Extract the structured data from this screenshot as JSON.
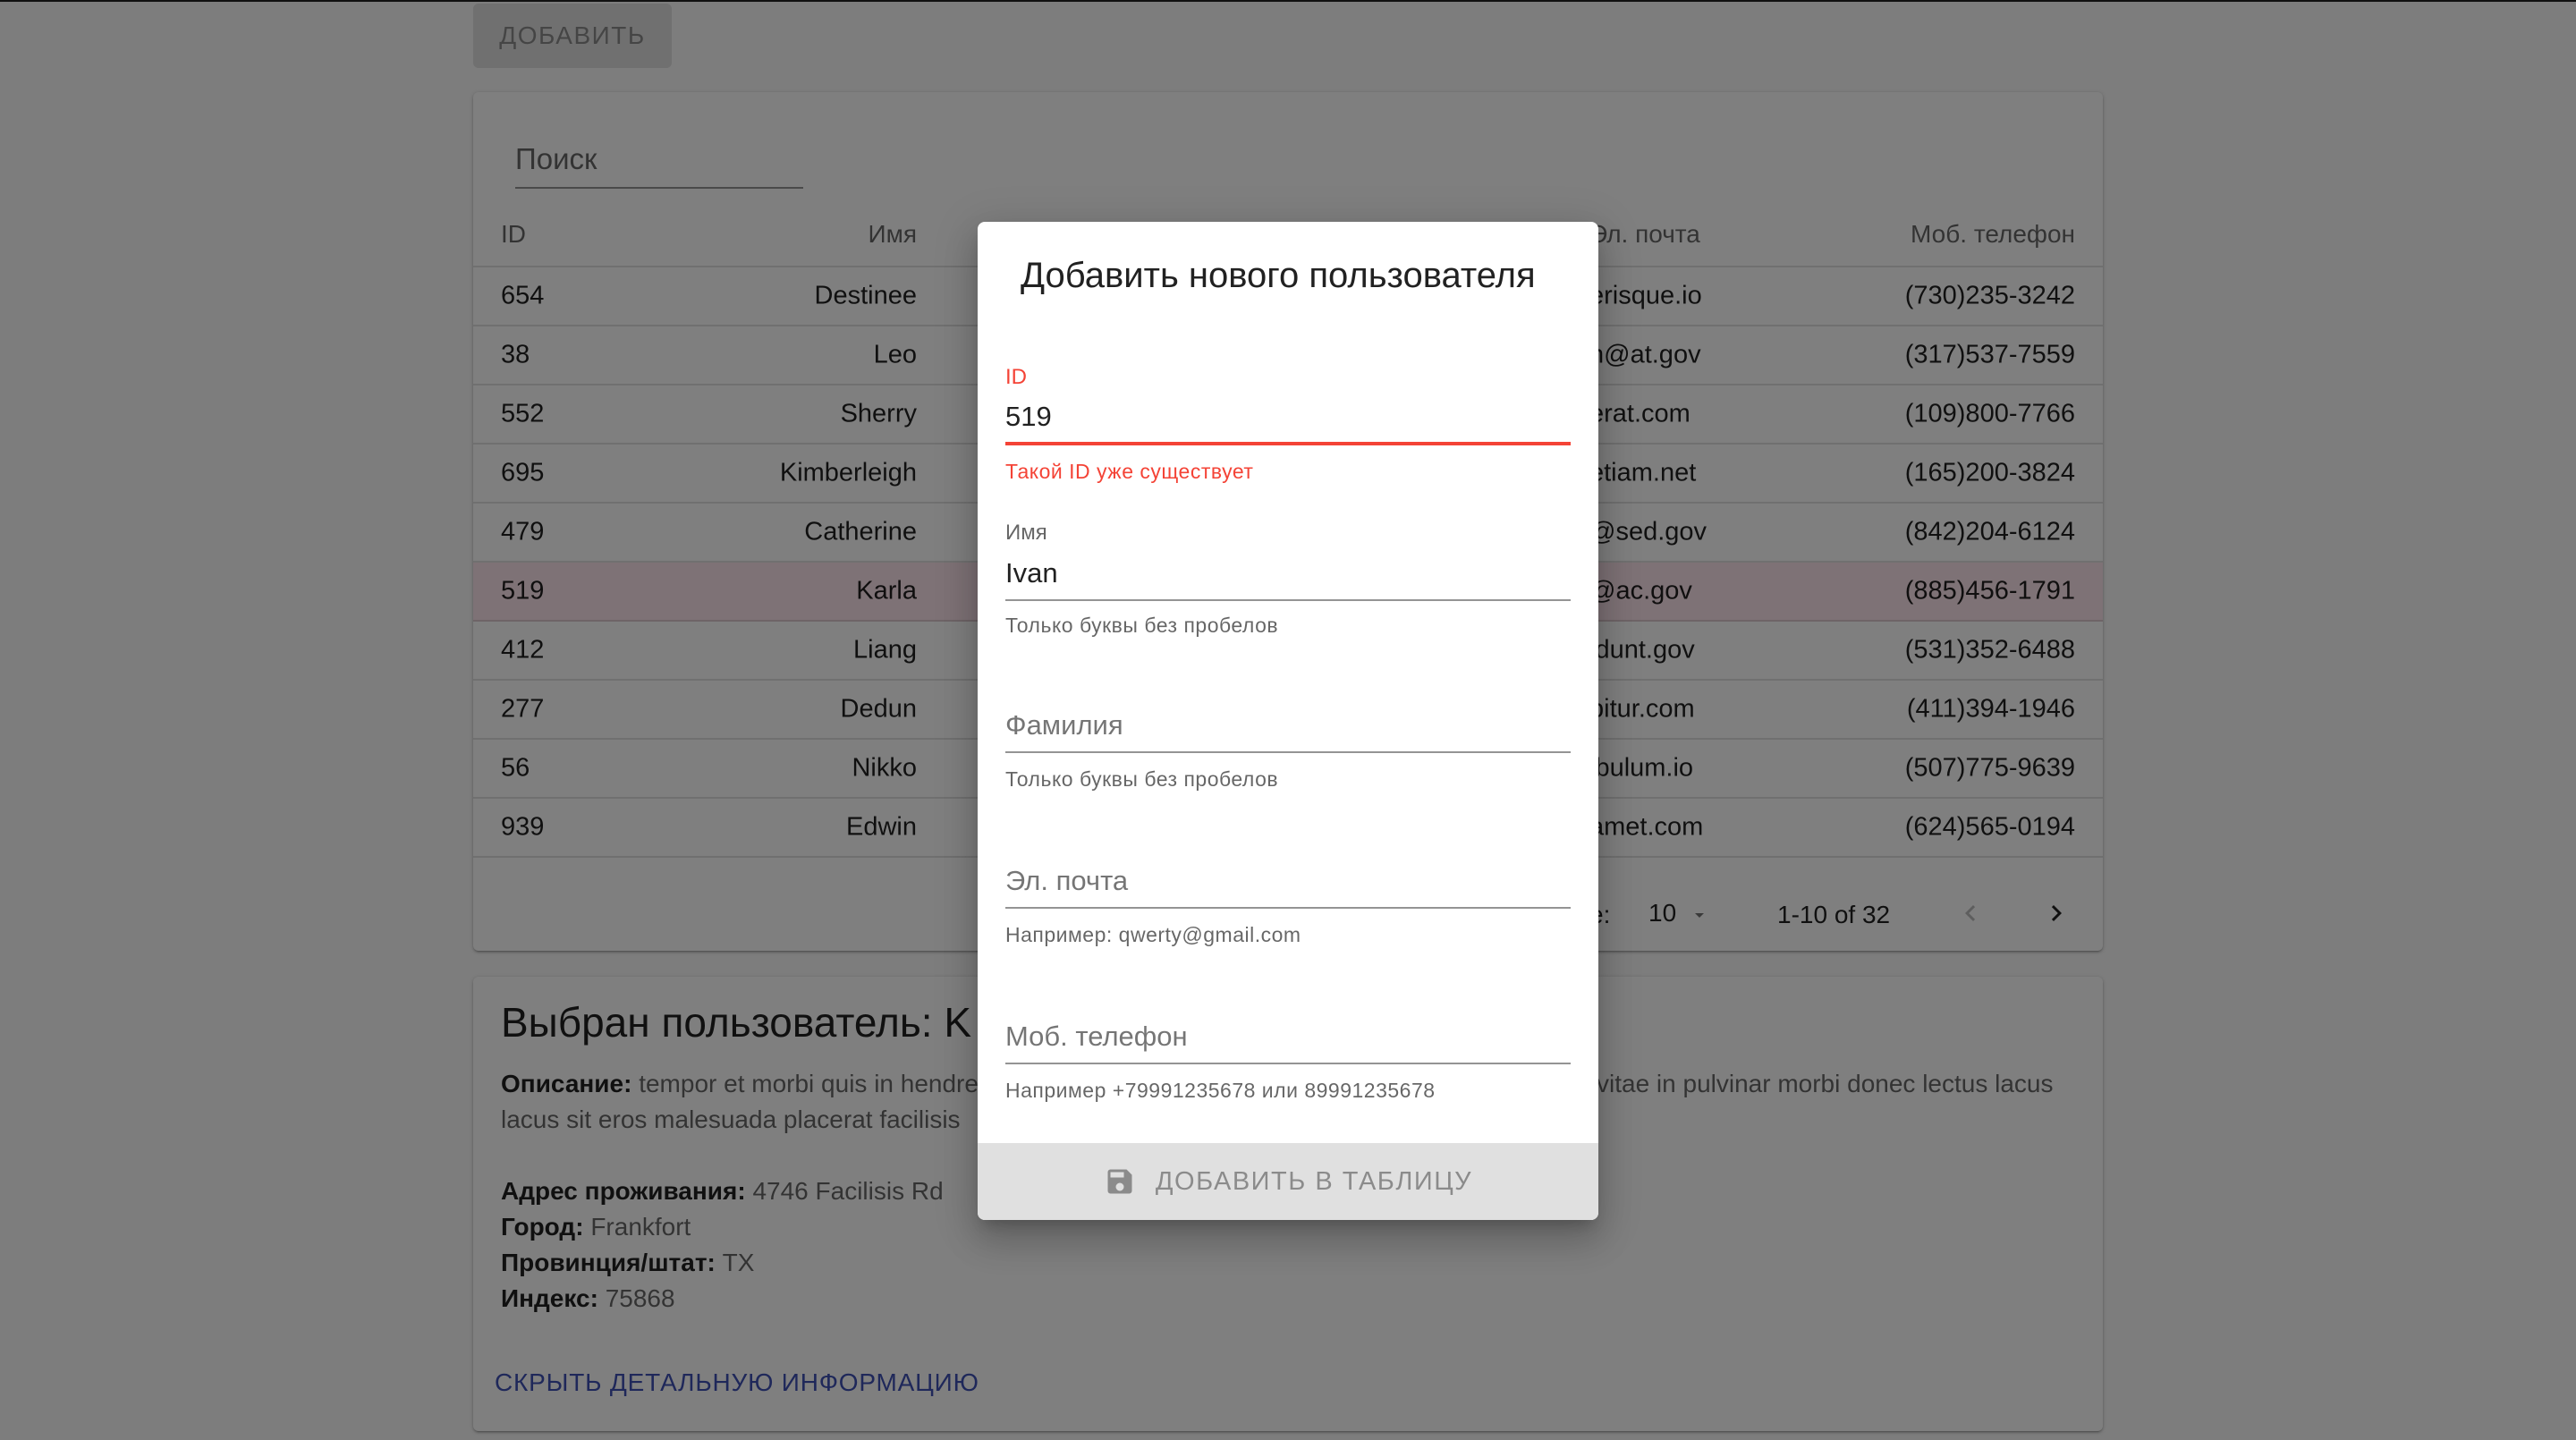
{
  "toolbar": {
    "add_label": "ДОБАВИТЬ"
  },
  "table": {
    "search_placeholder": "Поиск",
    "columns": {
      "id": "ID",
      "name": "Имя",
      "email": "Эл. почта",
      "phone": "Моб. телефон"
    },
    "rows": [
      {
        "id": "654",
        "name": "Destinee",
        "email": "erisque.io",
        "phone": "(730)235-3242"
      },
      {
        "id": "38",
        "name": "Leo",
        "email": "n@at.gov",
        "phone": "(317)537-7559"
      },
      {
        "id": "552",
        "name": "Sherry",
        "email": "erat.com",
        "phone": "(109)800-7766"
      },
      {
        "id": "695",
        "name": "Kimberleigh",
        "email": "etiam.net",
        "phone": "(165)200-3824"
      },
      {
        "id": "479",
        "name": "Catherine",
        "email": "@sed.gov",
        "phone": "(842)204-6124"
      },
      {
        "id": "519",
        "name": "Karla",
        "email": "@ac.gov",
        "phone": "(885)456-1791"
      },
      {
        "id": "412",
        "name": "Liang",
        "email": "idunt.gov",
        "phone": "(531)352-6488"
      },
      {
        "id": "277",
        "name": "Dedun",
        "email": "bitur.com",
        "phone": "(411)394-1946"
      },
      {
        "id": "56",
        "name": "Nikko",
        "email": "ibulum.io",
        "phone": "(507)775-9639"
      },
      {
        "id": "939",
        "name": "Edwin",
        "email": "amet.com",
        "phone": "(624)565-0194"
      }
    ],
    "pagination": {
      "rows_label": "e:",
      "rows_value": "10",
      "range": "1-10 of 32"
    }
  },
  "details": {
    "title": "Выбран пользователь: K",
    "desc_label": "Описание:",
    "desc_line1_left": "tempor et morbi quis in hendre",
    "desc_line1_right": "vitae in pulvinar morbi donec lectus lacus",
    "desc_line2": "lacus sit eros malesuada placerat facilisis",
    "address_label": "Адрес проживания:",
    "address_value": "4746 Facilisis Rd",
    "city_label": "Город:",
    "city_value": "Frankfort",
    "state_label": "Провинция/штат:",
    "state_value": "TX",
    "zip_label": "Индекс:",
    "zip_value": "75868",
    "hide_link": "СКРЫТЬ ДЕТАЛЬНУЮ ИНФОРМАЦИЮ"
  },
  "dialog": {
    "title": "Добавить нового пользователя",
    "id_field": {
      "label": "ID",
      "value": "519",
      "helper": "Такой ID уже существует"
    },
    "name_field": {
      "label": "Имя",
      "value": "Ivan",
      "helper": "Только буквы без пробелов"
    },
    "surname_field": {
      "placeholder": "Фамилия",
      "helper": "Только буквы без пробелов"
    },
    "email_field": {
      "placeholder": "Эл. почта",
      "helper": "Например: qwerty@gmail.com"
    },
    "phone_field": {
      "placeholder": "Моб. телефон",
      "helper": "Например +79991235678 или 89991235678"
    },
    "submit_label": "ДОБАВИТЬ В ТАБЛИЦУ"
  },
  "colors": {
    "error": "#f44336",
    "link": "#3f51b5",
    "selected_row": "#fce4ec",
    "overlay": "rgba(0,0,0,0.5)"
  },
  "icons": {
    "submit": "save-icon",
    "next": "chevron-right-icon",
    "prev": "chevron-left-icon",
    "dropdown": "arrow-drop-down-icon"
  }
}
